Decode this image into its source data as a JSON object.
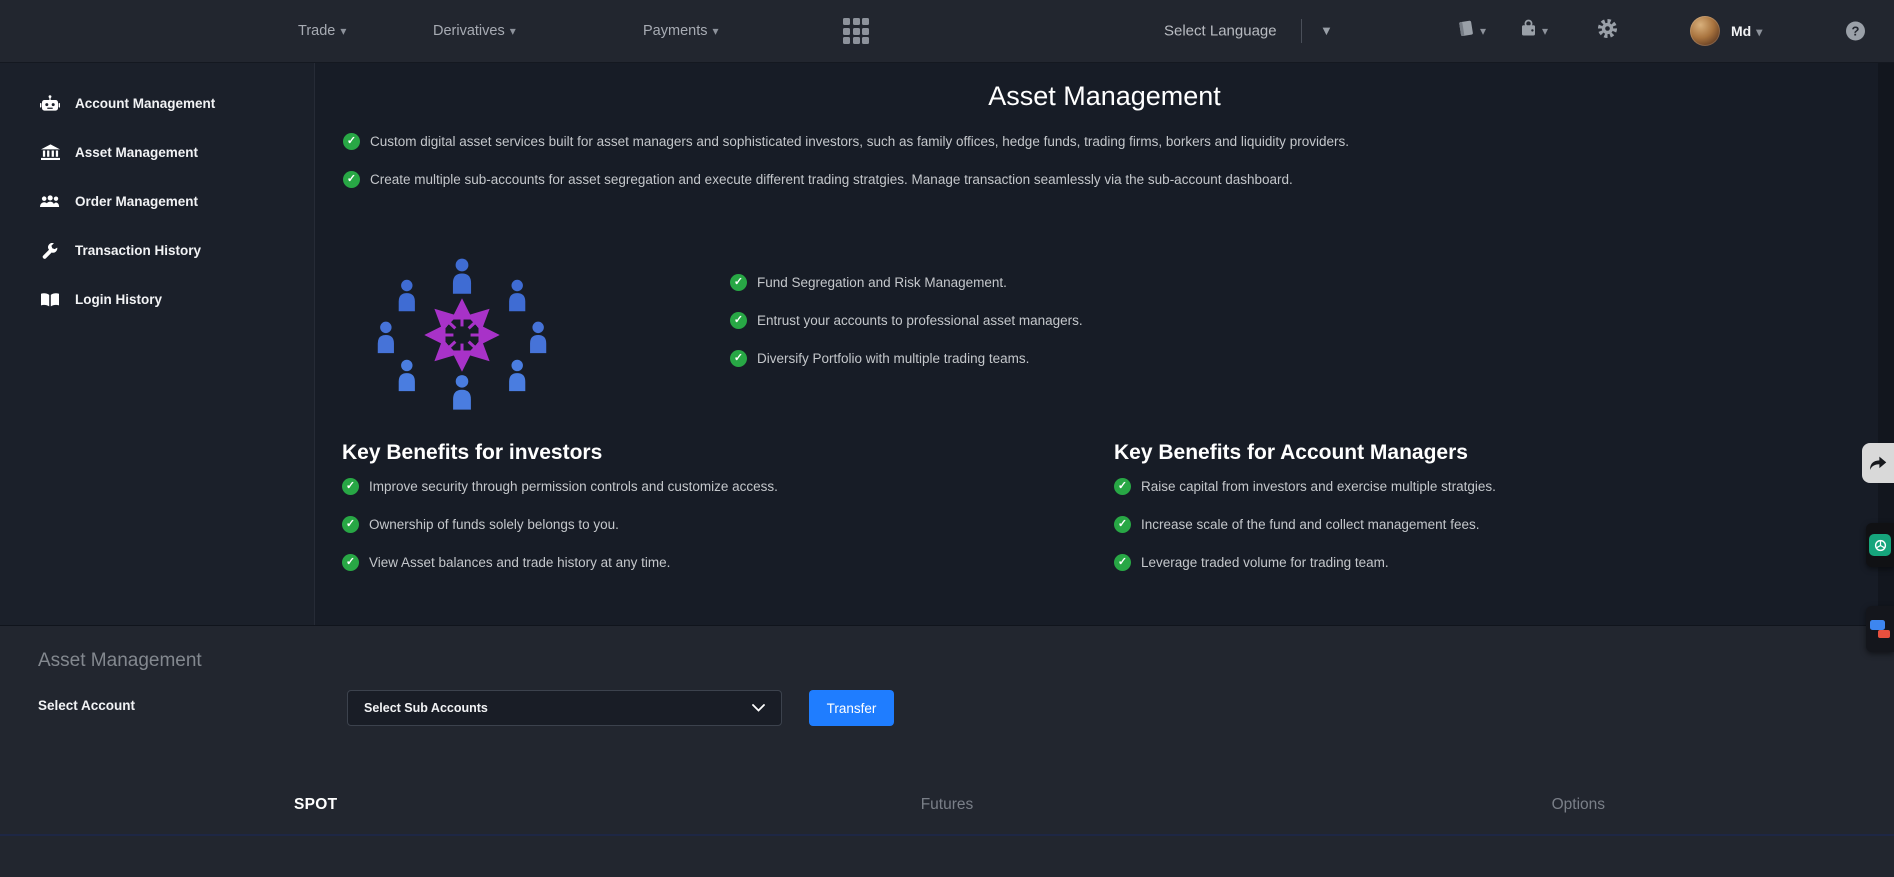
{
  "topbar": {
    "nav": [
      {
        "label": "Trade"
      },
      {
        "label": "Derivatives"
      },
      {
        "label": "Payments"
      }
    ],
    "language_label": "Select Language",
    "user_name": "Md"
  },
  "sidebar": {
    "items": [
      {
        "label": "Account Management",
        "icon": "robot-icon"
      },
      {
        "label": "Asset Management",
        "icon": "bank-icon"
      },
      {
        "label": "Order Management",
        "icon": "users-icon"
      },
      {
        "label": "Transaction History",
        "icon": "wrench-icon"
      },
      {
        "label": "Login History",
        "icon": "book-open-icon"
      }
    ]
  },
  "main": {
    "title": "Asset Management",
    "intro_bullets": [
      "Custom digital asset services built for asset managers and sophisticated investors, such as family offices, hedge funds, trading firms, borkers and liquidity providers.",
      "Create multiple sub-accounts for asset segregation and execute different trading stratgies. Manage transaction seamlessly via the sub-account dashboard."
    ],
    "feature_bullets": [
      "Fund Segregation and Risk Management.",
      "Entrust your accounts to professional asset managers.",
      "Diversify Portfolio with multiple trading teams."
    ],
    "benefits_investors": {
      "heading": "Key Benefits for investors",
      "bullets": [
        "Improve security through permission controls and customize access.",
        "Ownership of funds solely belongs to you.",
        "View Asset balances and trade history at any time."
      ]
    },
    "benefits_managers": {
      "heading": "Key Benefits for Account Managers",
      "bullets": [
        "Raise capital from investors and exercise multiple stratgies.",
        "Increase scale of the fund and collect management fees.",
        "Leverage traded volume for trading team."
      ]
    }
  },
  "transfer_panel": {
    "heading": "Asset Management",
    "account_label": "Select Account",
    "dropdown_value": "Select Sub Accounts",
    "transfer_label": "Transfer",
    "tabs": [
      {
        "label": "SPOT",
        "active": true
      },
      {
        "label": "Futures",
        "active": false
      },
      {
        "label": "Options",
        "active": false
      }
    ]
  },
  "icons": {
    "apps-grid-icon": "3x3-grid",
    "book-icon": "ledger-book",
    "wallet-icon": "wallet-bag",
    "gear-icon": "settings-gear",
    "help-icon": "?",
    "caret-down-icon": "▾",
    "language-dropdown-icon": "▼",
    "check-circle-icon": "✓",
    "chevron-down-icon": "⌄",
    "robot-icon": "robot-head",
    "bank-icon": "bank-building",
    "users-icon": "people-group",
    "wrench-icon": "wrench",
    "book-open-icon": "open-book",
    "share-arrow-icon": "curved-forward-arrow",
    "chatgpt-icon": "openai-logo",
    "chat-bubbles-icon": "messenger-bubbles"
  },
  "colors": {
    "accent_blue": "#1f7dff",
    "success_green": "#28a745",
    "person_blue": "#4673d8",
    "arrow_magenta": "#a832c8",
    "openai_green": "#16a57c",
    "topbar_bg": "#22262f",
    "sidebar_bg": "#1b202a",
    "main_bg": "#171c26"
  }
}
